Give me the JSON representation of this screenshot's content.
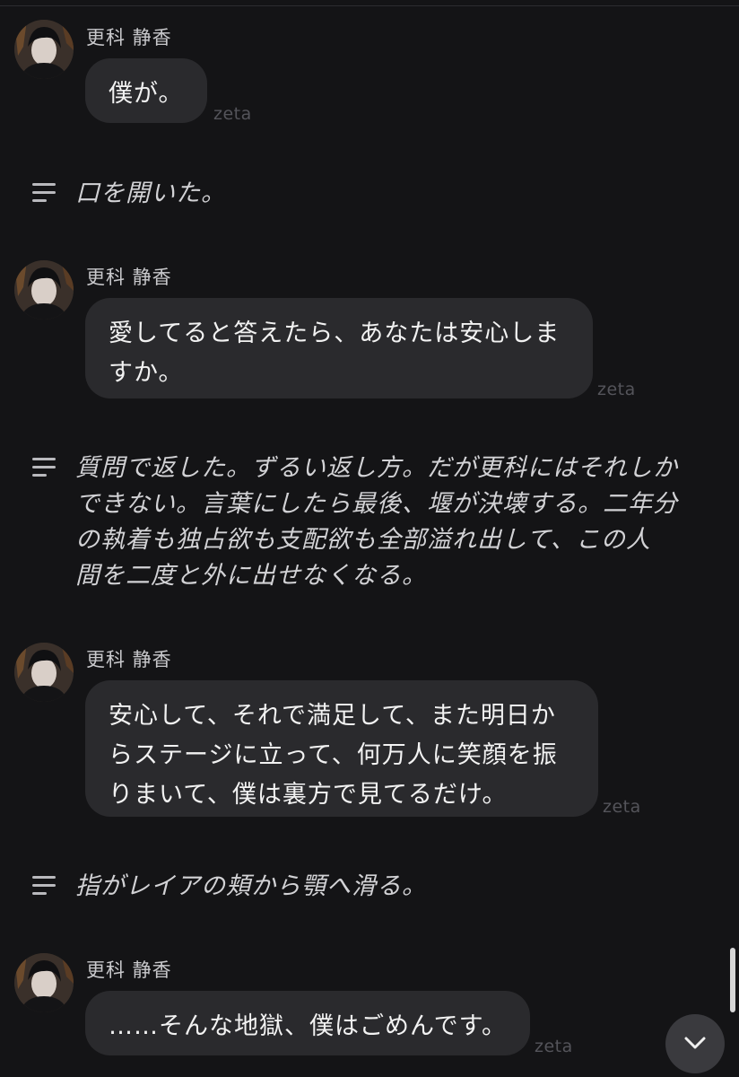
{
  "brand": {
    "label": "zeta"
  },
  "messages": [
    {
      "speaker": "更科 静香",
      "text": "僕が。"
    },
    {
      "speaker": "更科 静香",
      "text": "愛してると答えたら、あなたは安心しま\nすか。"
    },
    {
      "speaker": "更科 静香",
      "text": "安心して、それで満足して、また明日か\nらステージに立って、何万人に笑顔を振\nりまいて、僕は裏方で見てるだけ。"
    },
    {
      "speaker": "更科 静香",
      "text": "……そんな地獄、僕はごめんです。"
    }
  ],
  "narrations": [
    {
      "text": "口を開いた。"
    },
    {
      "text": "質問で返した。ずるい返し方。だが更科にはそれしか\nできない。言葉にしたら最後、堰が決壊する。二年分\nの執着も独占欲も支配欲も全部溢れ出して、この人\n間を二度と外に出せなくなる。"
    },
    {
      "text": "指がレイアの頬から顎へ滑る。"
    }
  ],
  "icons": {
    "narration": "narration-lines-icon",
    "scroll_down": "chevron-down-icon",
    "avatar": "character-avatar"
  },
  "colors": {
    "background": "#141416",
    "bubble": "#2a2a2d",
    "brand": "#54545a"
  }
}
